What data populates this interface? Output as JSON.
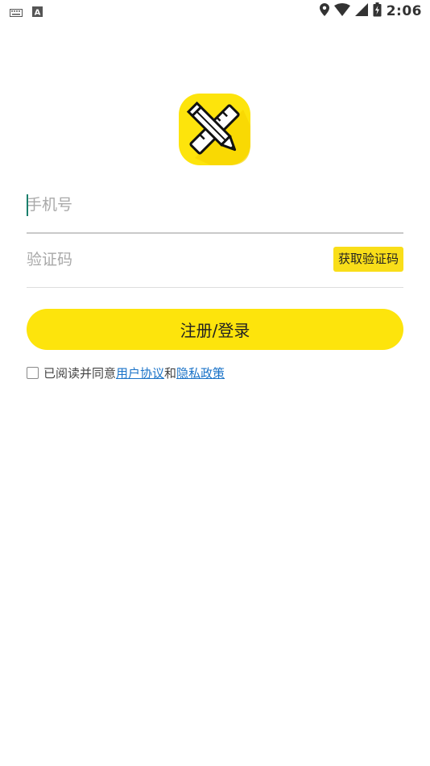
{
  "status_bar": {
    "time": "2:06",
    "left_icons": [
      "keyboard-icon",
      "text-a-icon"
    ],
    "right_icons": [
      "location-icon",
      "wifi-icon",
      "signal-icon",
      "battery-charging-icon"
    ]
  },
  "logo": {
    "icon": "pencil-ruler-icon",
    "background": "#fde40c"
  },
  "form": {
    "phone_placeholder": "手机号",
    "phone_value": "",
    "code_placeholder": "验证码",
    "code_value": "",
    "get_code_label": "获取验证码",
    "submit_label": "注册/登录"
  },
  "agreement": {
    "checked": false,
    "prefix": "已阅读并同意",
    "user_agreement": "用户协议",
    "connector": "和",
    "privacy_policy": "隐私政策"
  },
  "colors": {
    "accent": "#fde40c",
    "link": "#1a73c8",
    "caret": "#1a7f6c"
  }
}
